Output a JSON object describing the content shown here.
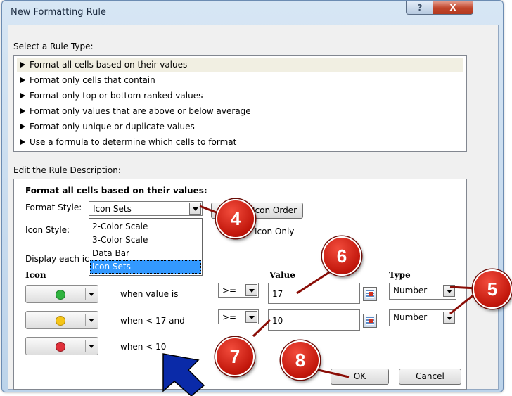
{
  "window": {
    "title": "New Formatting Rule",
    "help_glyph": "?",
    "close_glyph": "X"
  },
  "rule_type": {
    "label": "Select a Rule Type:",
    "items": [
      "Format all cells based on their values",
      "Format only cells that contain",
      "Format only top or bottom ranked values",
      "Format only values that are above or below average",
      "Format only unique or duplicate values",
      "Use a formula to determine which cells to format"
    ],
    "selected_index": 0
  },
  "description": {
    "label": "Edit the Rule Description:",
    "heading": "Format all cells based on their values:",
    "format_style_label": "Format Style:",
    "format_style_value": "Icon Sets",
    "icon_style_label": "Icon Style:",
    "reverse_order_label": "Icon Order",
    "show_icon_only_label": "Icon Only",
    "display_each_label": "Display each ico",
    "dropdown_options": [
      "2-Color Scale",
      "3-Color Scale",
      "Data Bar",
      "Icon Sets"
    ],
    "dropdown_highlighted": 3
  },
  "table": {
    "col_icon": "Icon",
    "col_value": "Value",
    "col_type": "Type",
    "rows": [
      {
        "icon": "green-circle-icon",
        "icon_color": "#2fb33f",
        "condition": "when value is",
        "operator": ">=",
        "value": "17",
        "type": "Number"
      },
      {
        "icon": "yellow-circle-icon",
        "icon_color": "#f5c518",
        "condition": "when < 17 and",
        "operator": ">=",
        "value": "10",
        "type": "Number"
      },
      {
        "icon": "red-circle-icon",
        "icon_color": "#e0303a",
        "condition": "when < 10"
      }
    ]
  },
  "buttons": {
    "ok": "OK",
    "cancel": "Cancel"
  },
  "callouts": [
    "4",
    "5",
    "6",
    "7",
    "8"
  ],
  "colors": {
    "callout": "#d11a0e",
    "arrow": "#0a2aa8",
    "highlight": "#3399ff"
  }
}
